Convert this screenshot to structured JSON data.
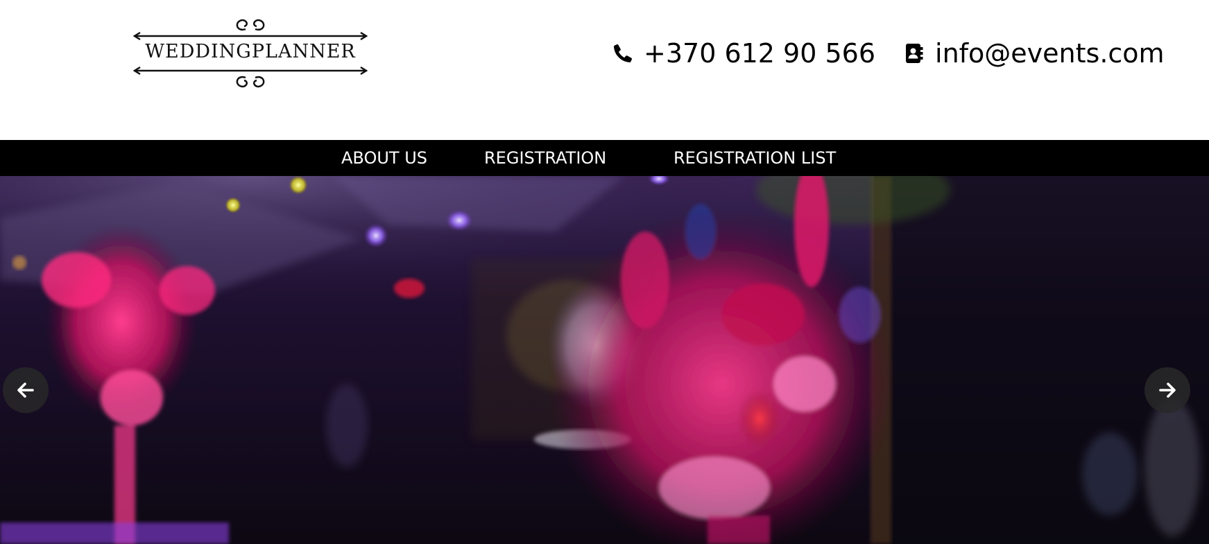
{
  "header": {
    "logo": {
      "text_part1": "WEDDING",
      "text_part2": "PLANNER"
    },
    "contacts": {
      "phone_icon": "phone-icon",
      "phone": "+370 612 90 566",
      "email_icon": "contact-card-icon",
      "email": "info@events.com"
    }
  },
  "nav": {
    "items": [
      {
        "label": "ABOUT US"
      },
      {
        "label": "REGISTRATION"
      },
      {
        "label": "REGISTRATION LIST"
      }
    ]
  },
  "hero": {
    "prev_icon": "arrow-left-icon",
    "next_icon": "arrow-right-icon"
  },
  "colors": {
    "nav_bg": "#000000",
    "nav_text": "#ffffff",
    "header_bg": "#ffffff",
    "hero_tone": "#2a1240",
    "flower_accent": "#e0157a"
  }
}
